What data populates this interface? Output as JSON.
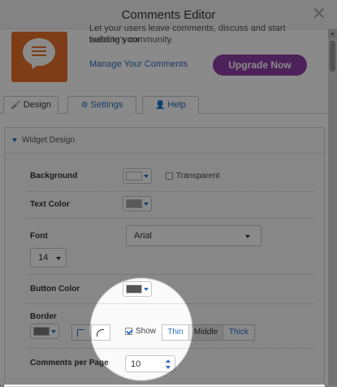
{
  "window": {
    "title": "Comments Editor"
  },
  "header": {
    "description_line1": "Let your users leave comments, discuss and start building your",
    "description_line2": "website's community.",
    "manage_link": "Manage Your Comments",
    "upgrade_button": "Upgrade Now"
  },
  "tabs": [
    {
      "label": "Design",
      "icon": "brush-icon",
      "active": true
    },
    {
      "label": "Settings",
      "icon": "gear-icon",
      "active": false
    },
    {
      "label": "Help",
      "icon": "user-icon",
      "active": false
    }
  ],
  "panel": {
    "title": "Widget Design",
    "background": {
      "label": "Background",
      "color": "#ffffff",
      "transparent_label": "Transparent",
      "transparent_checked": false
    },
    "text_color": {
      "label": "Text Color",
      "color": "#a6a6a6"
    },
    "font": {
      "label": "Font",
      "family": "Arial",
      "size": "14"
    },
    "button_color": {
      "label": "Button Color",
      "color": "#555555"
    },
    "border": {
      "label": "Border",
      "color": "#7a7a7a",
      "show_label": "Show",
      "show_checked": true,
      "thickness_options": [
        "Thin",
        "Middle",
        "Thick"
      ],
      "thickness_selected": "Middle"
    },
    "comments_per_page": {
      "label": "Comments per Page",
      "value": "10"
    }
  },
  "colors": {
    "accent": "#2a6fbf",
    "upgrade": "#8e3fa8",
    "logo": "#e8712a"
  }
}
